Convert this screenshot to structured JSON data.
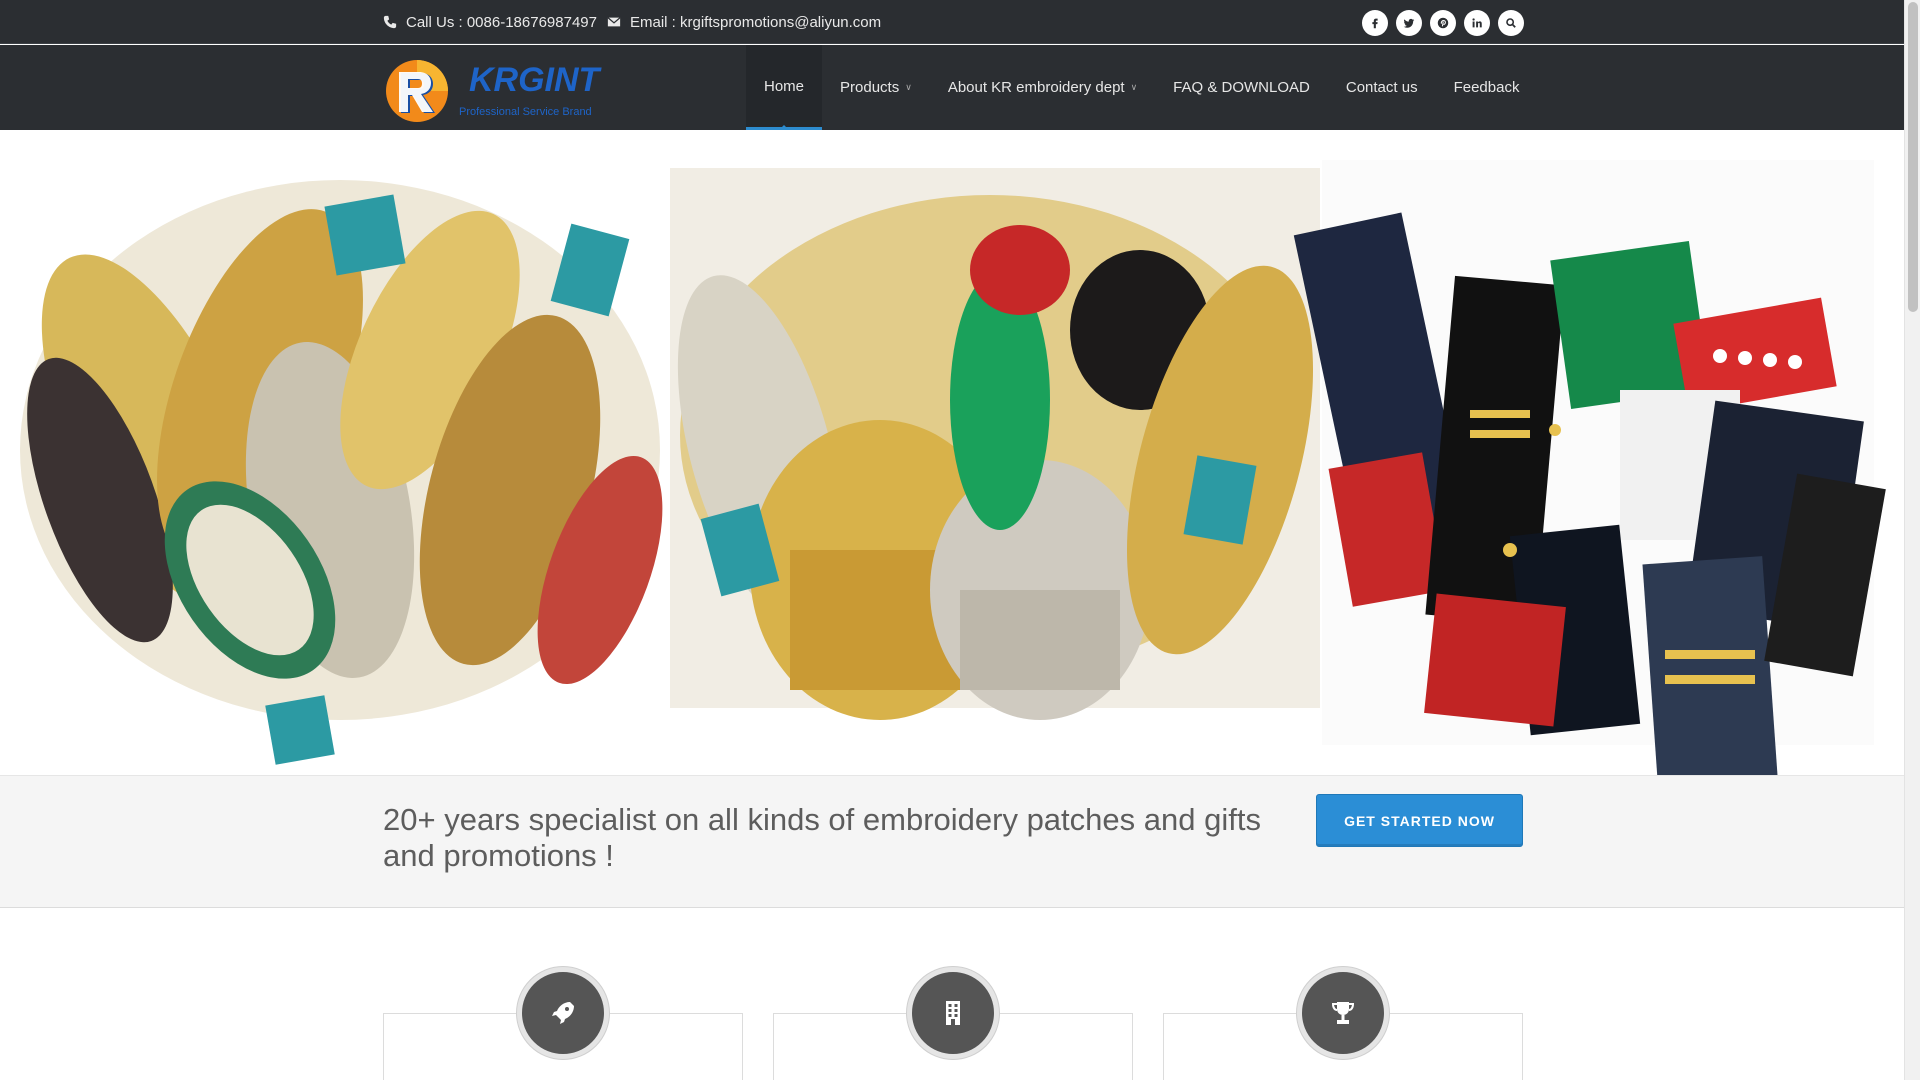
{
  "topbar": {
    "phone_text": "Call Us : 0086-18676987497",
    "email_text": "Email : krgiftspromotions@aliyun.com",
    "social_icons": [
      "facebook-icon",
      "twitter-icon",
      "pinterest-icon",
      "linkedin-icon",
      "search-icon"
    ]
  },
  "logo": {
    "brand": "KRGINT",
    "tagline": "Professional Service Brand"
  },
  "nav": {
    "items": [
      {
        "label": "Home",
        "active": true,
        "dropdown": false
      },
      {
        "label": "Products",
        "active": false,
        "dropdown": true
      },
      {
        "label": "About KR embroidery dept",
        "active": false,
        "dropdown": true
      },
      {
        "label": "FAQ & DOWNLOAD",
        "active": false,
        "dropdown": false
      },
      {
        "label": "Contact us",
        "active": false,
        "dropdown": false
      },
      {
        "label": "Feedback",
        "active": false,
        "dropdown": false
      }
    ]
  },
  "hero": {
    "image_icons": [
      "shoulder-boards-image",
      "epaulettes-image",
      "rank-insignia-image"
    ]
  },
  "promo": {
    "headline": "20+ years specialist on all kinds of embroidery patches and gifts and promotions !",
    "cta_label": "GET STARTED NOW"
  },
  "features": {
    "icons": [
      "rocket-icon",
      "building-icon",
      "trophy-icon"
    ]
  },
  "colors": {
    "header_bg": "#2b2e32",
    "accent": "#2b8ed6",
    "promo_bg": "#f5f5f5"
  }
}
